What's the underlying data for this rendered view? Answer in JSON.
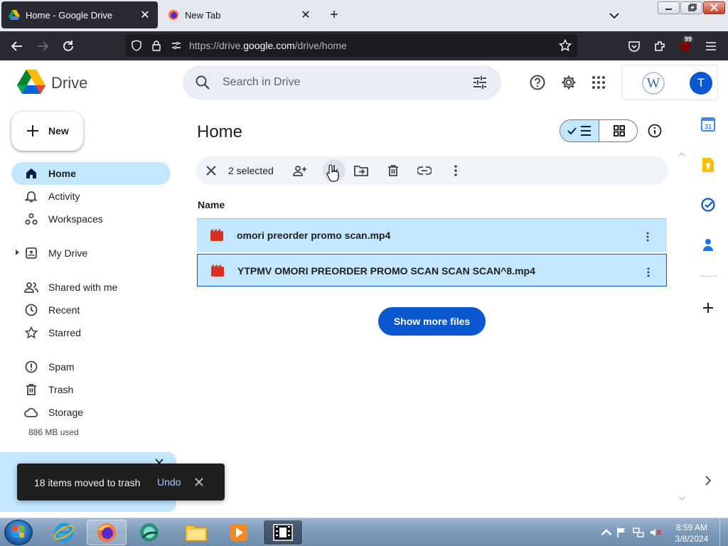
{
  "browser": {
    "tabs": [
      {
        "title": "Home - Google Drive",
        "close": "✕"
      },
      {
        "title": "New Tab",
        "close": "✕"
      }
    ],
    "new_tab": "+",
    "url": {
      "prefix": "https://drive.",
      "host": "google.com",
      "path": "/drive/home"
    },
    "extension_badge": "99"
  },
  "drive": {
    "app_name": "Drive",
    "search": {
      "placeholder": "Search in Drive",
      "value": ""
    },
    "account": {
      "avatar_letter": "T",
      "workspace_logo": "W"
    },
    "new_button": "New",
    "nav": [
      {
        "label": "Home",
        "icon": "home-icon",
        "active": true
      },
      {
        "label": "Activity",
        "icon": "bell-icon"
      },
      {
        "label": "Workspaces",
        "icon": "workspaces-icon"
      },
      {
        "label": "My Drive",
        "icon": "my-drive-icon"
      },
      {
        "label": "Shared with me",
        "icon": "people-icon"
      },
      {
        "label": "Recent",
        "icon": "clock-icon"
      },
      {
        "label": "Starred",
        "icon": "star-icon"
      },
      {
        "label": "Spam",
        "icon": "spam-icon"
      },
      {
        "label": "Trash",
        "icon": "trash-icon"
      },
      {
        "label": "Storage",
        "icon": "cloud-icon"
      }
    ],
    "storage_used": "886 MB used",
    "page_title": "Home",
    "selection": {
      "count_label": "2 selected"
    },
    "column_header": "Name",
    "files": [
      {
        "name": "omori preorder promo scan.mp4",
        "type": "video"
      },
      {
        "name": "YTPMV OMORI PREORDER PROMO SCAN SCAN SCAN^8.mp4",
        "type": "video"
      }
    ],
    "show_more": "Show more files",
    "snackbar": {
      "message": "18 items moved to trash",
      "action": "Undo"
    },
    "side_panel": {
      "calendar_day": "31"
    }
  },
  "taskbar": {
    "time": "8:59 AM",
    "date": "3/8/2024"
  },
  "colors": {
    "selection": "#c2e7ff",
    "primary": "#0b57d0",
    "browser_dark": "#2b2a33"
  }
}
